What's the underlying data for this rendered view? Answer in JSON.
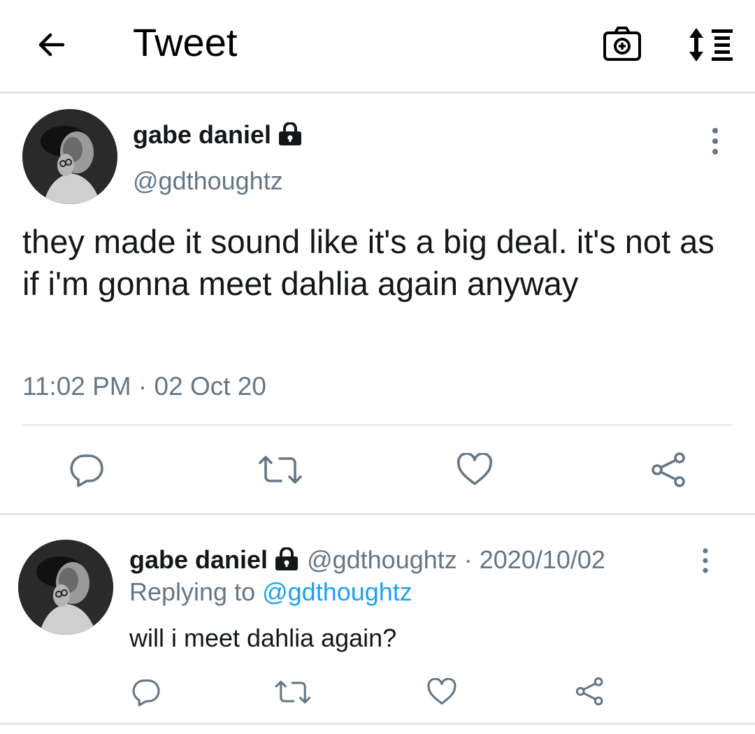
{
  "header": {
    "title": "Tweet",
    "back_icon": "arrow-left-icon",
    "camera_icon": "camera-plus-icon",
    "sort_icon": "sort-list-icon"
  },
  "tweet": {
    "author_name": "gabe daniel",
    "handle": "@gdthoughtz",
    "protected_icon": "lock-icon",
    "text": "they made it sound like it's a big deal. it's not as if i'm gonna meet dahlia again anyway",
    "timestamp": "11:02 PM · 02 Oct 20",
    "actions": [
      "reply-icon",
      "retweet-icon",
      "like-icon",
      "share-icon"
    ]
  },
  "reply": {
    "author_name": "gabe daniel",
    "handle_date": "@gdthoughtz · 2020/10/02",
    "replying_prefix": "Replying to ",
    "replying_to": "@gdthoughtz",
    "text": "will i meet dahlia again?",
    "actions": [
      "reply-icon",
      "retweet-icon",
      "like-icon",
      "share-icon"
    ]
  },
  "colors": {
    "text_primary": "#14171a",
    "text_secondary": "#657786",
    "link": "#1da1f2",
    "divider": "#e1e4e6"
  }
}
